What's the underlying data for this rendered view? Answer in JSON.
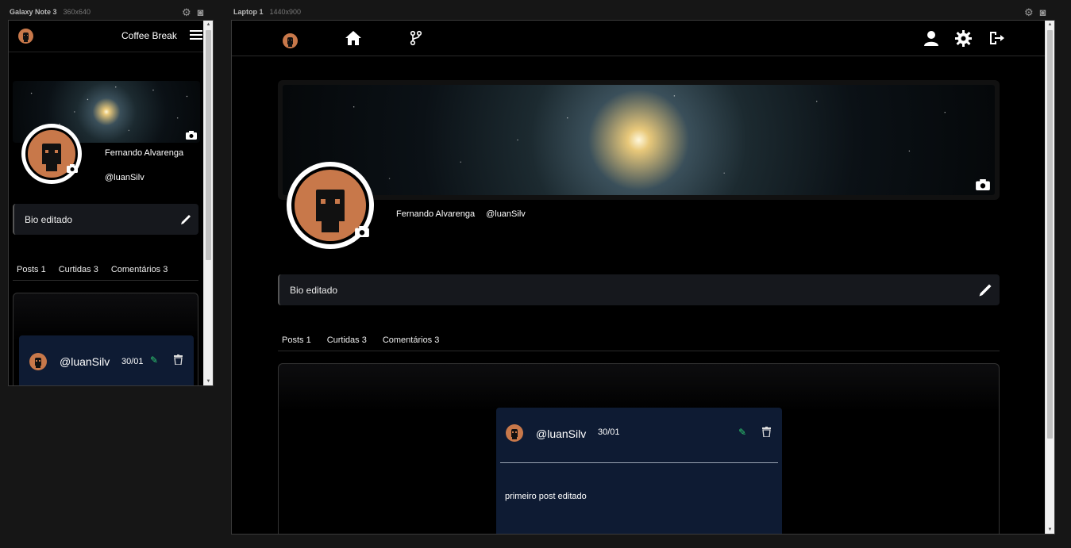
{
  "frames": {
    "mobile": {
      "name": "Galaxy Note 3",
      "size": "360x640"
    },
    "laptop": {
      "name": "Laptop 1",
      "size": "1440x900"
    }
  },
  "app": {
    "title": "Coffee Break"
  },
  "profile": {
    "name": "Fernando Alvarenga",
    "handle": "@luanSilv",
    "bio": "Bio editado"
  },
  "tabs": [
    "Posts 1",
    "Curtidas 3",
    "Comentários 3"
  ],
  "post": {
    "author": "@luanSilv",
    "date": "30/01",
    "content": "primeiro post editado"
  },
  "icons": {
    "nav": [
      "home-icon",
      "fork-icon"
    ],
    "actions": [
      "user-icon",
      "gear-icon",
      "logout-icon"
    ]
  },
  "colors": {
    "accent": "#c8784a",
    "post_bg": "#0e1b33",
    "edit": "#2ecc71"
  }
}
